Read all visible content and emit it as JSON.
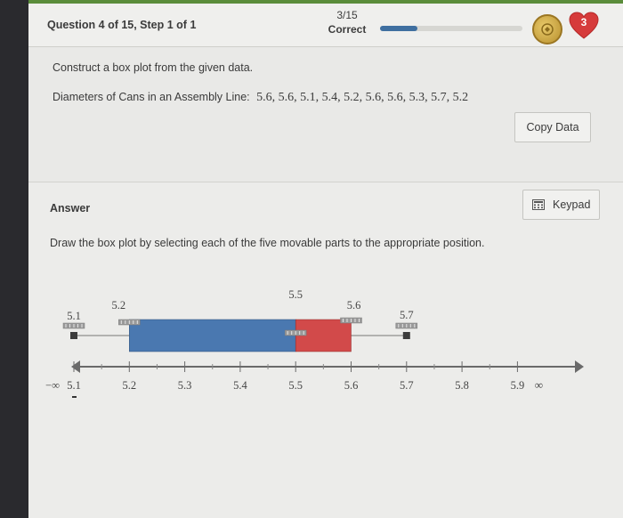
{
  "header": {
    "question_title": "Question 4 of 15, Step 1 of 1",
    "score_fraction": "3/15",
    "score_label": "Correct",
    "progress_fraction": 0.26,
    "hearts": "3"
  },
  "question": {
    "prompt": "Construct a box plot from the given data.",
    "data_label": "Diameters of Cans in an Assembly Line:",
    "data_values": "5.6, 5.6, 5.1, 5.4, 5.2, 5.6, 5.6, 5.3, 5.7, 5.2",
    "copy_button": "Copy Data"
  },
  "answer": {
    "label": "Answer",
    "keypad_button": "Keypad",
    "instruction": "Draw the box plot by selecting each of the five movable parts to the appropriate position."
  },
  "box_plot": {
    "axis_ticks": [
      "5.1",
      "5.2",
      "5.3",
      "5.4",
      "5.5",
      "5.6",
      "5.7",
      "5.8",
      "5.9"
    ],
    "axis_min_label": "−∞",
    "axis_max_label": "∞",
    "min": 5.1,
    "q1": 5.2,
    "median": 5.5,
    "q3": 5.6,
    "max": 5.7,
    "handle_labels": {
      "min": "5.1",
      "q1": "5.2",
      "median": "5.5",
      "q3": "5.6",
      "max": "5.7"
    },
    "colors": {
      "left_box": "#4a78b0",
      "right_box": "#d24a4a"
    }
  }
}
